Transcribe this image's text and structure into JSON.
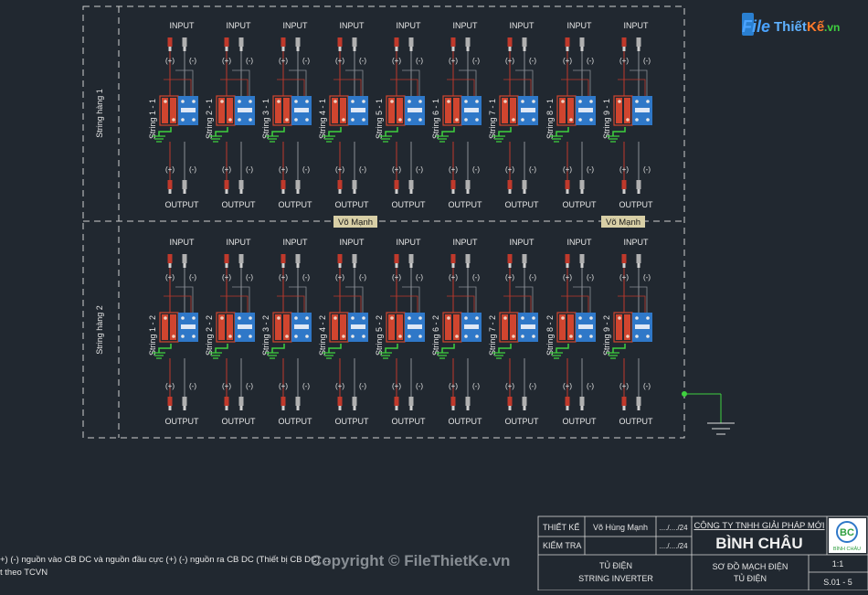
{
  "colors": {
    "background": "#212830",
    "wire_red": "#c0392b",
    "wire_grey": "#8a8f96",
    "breaker_red": "#d0452f",
    "breaker_blue": "#2f78c8",
    "ground_green": "#3fd13f",
    "text": "#e6e6e6",
    "watermark_blue": "#2a7fd0",
    "tag_bg": "#d8cfa6"
  },
  "labels": {
    "input": "INPUT",
    "output": "OUTPUT",
    "plus": "(+)",
    "minus": "(-)"
  },
  "rows": [
    {
      "label": "String hàng 1",
      "strings": [
        "String 1 - 1",
        "String 2 - 1",
        "String 3 - 1",
        "String 4 - 1",
        "String 5 - 1",
        "String 6 - 1",
        "String 7 - 1",
        "String 8 - 1",
        "String 9 - 1"
      ]
    },
    {
      "label": "String hàng 2",
      "strings": [
        "String 1 - 2",
        "String 2 - 2",
        "String 3 - 2",
        "String 4 - 2",
        "String 5 - 2",
        "String 6 - 2",
        "String 7 - 2",
        "String 8 - 2",
        "String 9 - 2"
      ]
    }
  ],
  "tags": [
    "Võ Mạnh",
    "Võ Mạnh"
  ],
  "watermark": {
    "logo_file": "File",
    "logo_thiet": "Thiết",
    "logo_ke": "Kế",
    "logo_vn": ".vn",
    "copyright": "Copyright © FileThietKe.vn"
  },
  "notes": [
    "+) (-) nguồn vào CB DC và nguồn đầu cực (+) (-) nguồn ra CB DC (Thiết bị CB DC) ... ",
    "t theo TCVN"
  ],
  "title_block": {
    "designer_label": "THIẾT KẾ",
    "designer_name": "Võ Hùng Mạnh",
    "designer_date": "..../..../24",
    "checker_label": "KIỂM TRA",
    "checker_date": "..../..../24",
    "company_line1": "CÔNG TY TNHH GIẢI PHÁP MỚI",
    "company_line2": "BÌNH CHÂU",
    "logo_text": "BC",
    "logo_caption": "BÌNH CHÂU",
    "panel_line1": "TỦ ĐIỆN",
    "panel_line2": "STRING INVERTER",
    "drawing_line1": "SƠ ĐỒ MẠCH ĐIỆN",
    "drawing_line2": "TỦ ĐIỆN",
    "scale": "1:1",
    "sheet": "S.01 - 5"
  }
}
